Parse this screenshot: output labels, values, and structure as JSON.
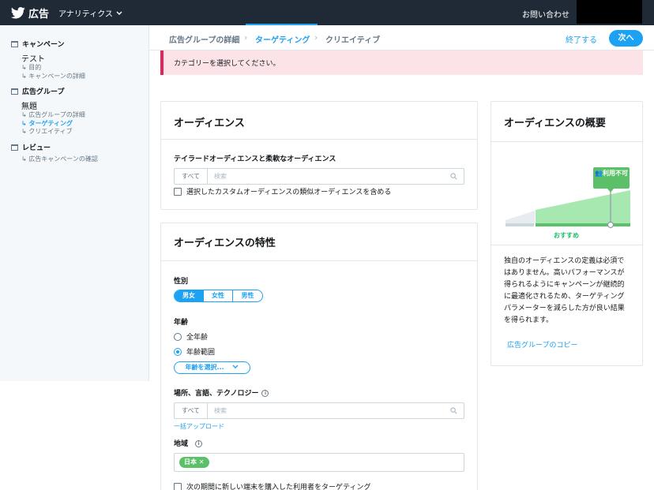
{
  "topbar": {
    "brand": "広告",
    "menu_label": "アナリティクス",
    "contact": "お問い合わせ"
  },
  "sidebar": {
    "campaign_header": "キャンペーン",
    "campaign_title": "テスト",
    "campaign_sub1": "↳ 目的",
    "campaign_sub2": "↳ キャンペーンの詳細",
    "adgroup_header": "広告グループ",
    "adgroup_title": "無題",
    "adgroup_sub1": "↳ 広告グループの詳細",
    "adgroup_sub2": "↳ ターゲティング",
    "adgroup_sub3": "↳ クリエイティブ",
    "review_header": "レビュー",
    "review_sub1": "↳ 広告キャンペーンの確認"
  },
  "steps": {
    "step1": "広告グループの詳細",
    "step2": "ターゲティング",
    "step3": "クリエイティブ",
    "end": "終了する",
    "next": "次へ"
  },
  "alert": "カテゴリーを選択してください。",
  "audience": {
    "title": "オーディエンス",
    "section_label": "テイラードオーディエンスと柔軟なオーディエンス",
    "scope": "すべて",
    "search_placeholder": "検索",
    "lookalike_label": "選択したカスタムオーディエンスの類似オーディエンスを含める"
  },
  "traits": {
    "title": "オーディエンスの特性",
    "gender_label": "性別",
    "gender_options": [
      "男女",
      "女性",
      "男性"
    ],
    "age_label": "年齢",
    "age_all": "全年齢",
    "age_range": "年齢範囲",
    "age_select": "年齢を選択...",
    "location_label": "場所、言語、テクノロジー",
    "location_scope": "すべて",
    "location_placeholder": "検索",
    "bulk_upload": "一括アップロード",
    "region_label": "地域",
    "region_tag": "日本 ✕",
    "new_device_label": "次の期間に新しい端末を購入した利用者をターゲティング"
  },
  "summary": {
    "title": "オーディエンスの概要",
    "badge": "利用不可",
    "meter_label": "おすすめ",
    "text": "独自のオーディエンスの定義は必須ではありません。高いパフォーマンスが得られるようにキャンペーンが継続的に最適化されるため、ターゲティングパラメーターを減らした方が良い結果を得られます。",
    "copy_link": "広告グループのコピー"
  },
  "colors": {
    "topbar": "#1f2a36",
    "accent": "#1da1f2",
    "alert_bg": "#fbe3e8",
    "alert_border": "#e0245e",
    "meter_green": "#a6e8b0",
    "badge_green": "#5cc069"
  }
}
